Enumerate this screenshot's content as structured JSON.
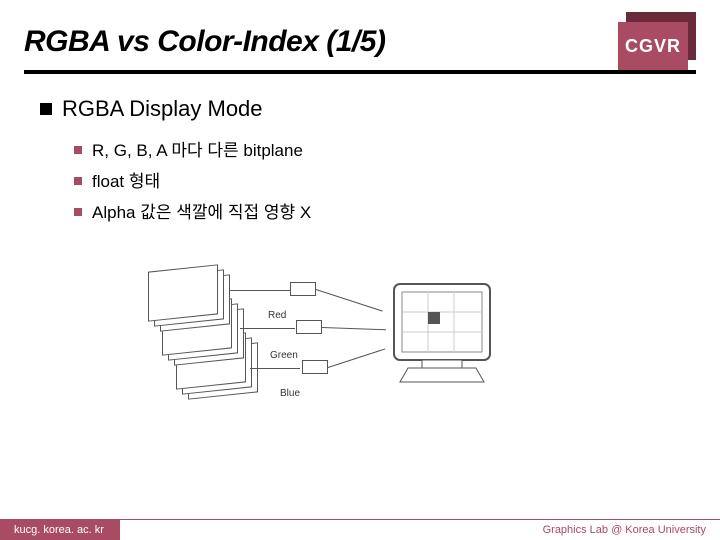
{
  "title": "RGBA vs Color-Index (1/5)",
  "badge": "CGVR",
  "heading": "RGBA Display Mode",
  "bullets": [
    "R, G, B, A 마다 다른 bitplane",
    "float 형태",
    "Alpha 값은 색깔에 직접 영향 X"
  ],
  "diagram_labels": {
    "red": "Red",
    "green": "Green",
    "blue": "Blue"
  },
  "footer_left": "kucg. korea. ac. kr",
  "footer_right": "Graphics Lab @ Korea University"
}
